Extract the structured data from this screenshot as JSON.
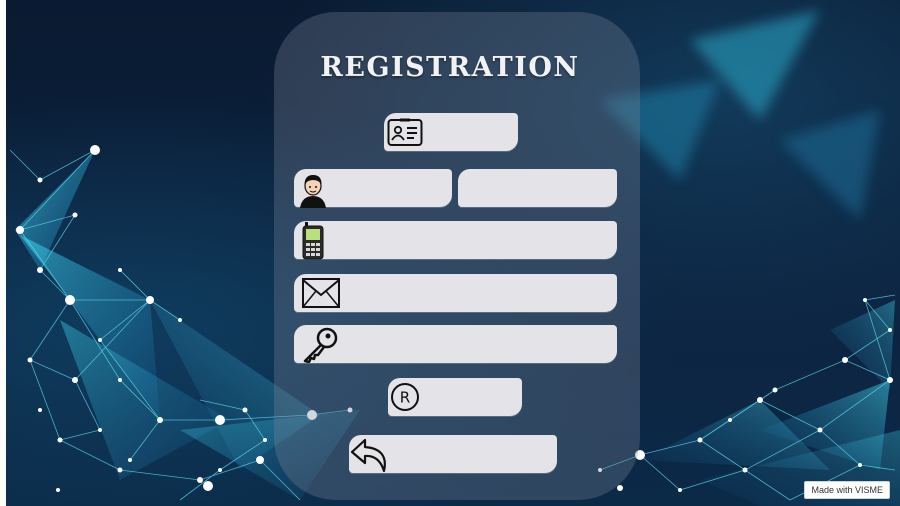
{
  "form": {
    "title": "REGISTRATION",
    "fields": {
      "id_card": {
        "icon": "id-card-icon",
        "value": ""
      },
      "first_name": {
        "icon": "person-icon",
        "value": ""
      },
      "last_name": {
        "value": ""
      },
      "phone": {
        "icon": "mobile-phone-icon",
        "value": ""
      },
      "email": {
        "icon": "envelope-icon",
        "value": ""
      },
      "password": {
        "icon": "key-icon",
        "value": ""
      }
    },
    "register_button": {
      "icon": "registered-icon",
      "glyph": "R"
    },
    "back_button": {
      "icon": "undo-arrow-icon"
    }
  },
  "badge": {
    "text": "Made with VISME"
  },
  "colors": {
    "background": "#0b1b33",
    "panel": "#6e7890",
    "field": "#e3e3e8",
    "network": "#35d6f0"
  }
}
